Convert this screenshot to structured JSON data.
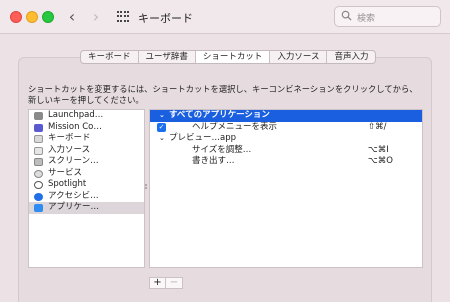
{
  "window": {
    "title": "キーボード",
    "search_placeholder": "検索"
  },
  "tabs": [
    {
      "label": "キーボード",
      "active": false
    },
    {
      "label": "ユーザ辞書",
      "active": false
    },
    {
      "label": "ショートカット",
      "active": true
    },
    {
      "label": "入力ソース",
      "active": false
    },
    {
      "label": "音声入力",
      "active": false
    }
  ],
  "description": "ショートカットを変更するには、ショートカットを選択し、キーコンビネーションをクリックしてから、新しいキーを押してください。",
  "categories": [
    {
      "label": "Launchpad…",
      "icon": "launchpad-icon"
    },
    {
      "label": "Mission Co…",
      "icon": "mission-control-icon"
    },
    {
      "label": "キーボード",
      "icon": "keyboard-icon"
    },
    {
      "label": "入力ソース",
      "icon": "input-source-icon"
    },
    {
      "label": "スクリーン…",
      "icon": "screenshot-icon"
    },
    {
      "label": "サービス",
      "icon": "services-icon"
    },
    {
      "label": "Spotlight",
      "icon": "spotlight-icon"
    },
    {
      "label": "アクセシビ…",
      "icon": "accessibility-icon"
    },
    {
      "label": "アプリケー…",
      "icon": "app-shortcuts-icon",
      "selected": true
    }
  ],
  "shortcuts": {
    "all_apps_header": "すべてのアプリケーション",
    "help_menu_label": "ヘルプメニューを表示",
    "help_menu_shortcut": "⇧⌘/",
    "preview_app": "プレビュー…app",
    "adjust_size_label": "サイズを調整…",
    "adjust_size_shortcut": "⌥⌘I",
    "export_label": "書き出す…",
    "export_shortcut": "⌥⌘O"
  },
  "buttons": {
    "add": "+",
    "remove": "−"
  }
}
